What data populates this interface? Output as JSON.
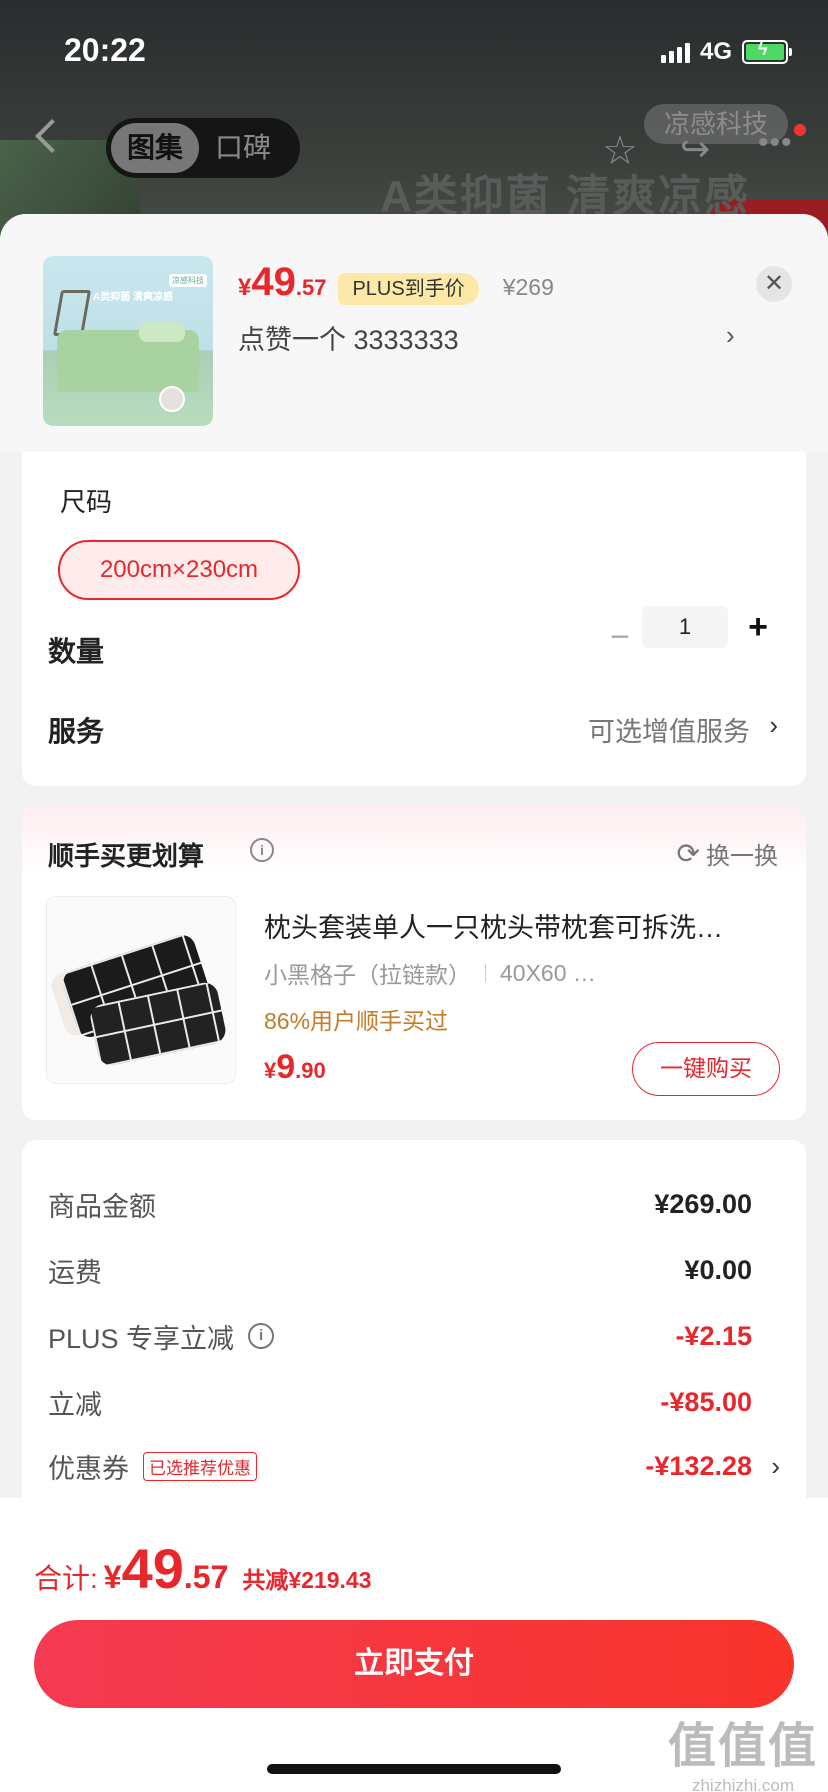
{
  "status_bar": {
    "time": "20:22",
    "network": "4G"
  },
  "background_page": {
    "tabs": [
      "图集",
      "口碑"
    ],
    "brand": "凉感科技",
    "slogan": "A类抑菌 清爽凉感"
  },
  "product": {
    "thumb_text": "A类抑菌 清爽凉感",
    "thumb_tag": "凉感科技",
    "price_symbol": "¥",
    "price_int": "49",
    "price_dec": ".57",
    "plus_badge": "PLUS到手价",
    "original_price": "¥269",
    "spec_text": "点赞一个  3333333"
  },
  "options": {
    "size_label": "尺码",
    "size_selected": "200cm×230cm",
    "qty_label": "数量",
    "qty_value": "1",
    "service_label": "服务",
    "service_value": "可选增值服务"
  },
  "addon": {
    "title": "顺手买更划算",
    "swap_label": "换一换",
    "name": "枕头套装单人一只枕头带枕套可拆洗…",
    "spec_a": "小黑格子（拉链款）",
    "spec_b": "40X60 …",
    "rate": "86%用户顺手买过",
    "price_symbol": "¥",
    "price_int": "9",
    "price_dec": ".90",
    "buy_label": "一键购买"
  },
  "summary": {
    "rows": [
      {
        "label": "商品金额",
        "value": "¥269.00"
      },
      {
        "label": "运费",
        "value": "¥0.00"
      },
      {
        "label": "PLUS 专享立减",
        "value": "-¥2.15"
      },
      {
        "label": "立减",
        "value": "-¥85.00"
      },
      {
        "label": "优惠券",
        "value": "-¥132.28",
        "tag": "已选推荐优惠"
      }
    ]
  },
  "footer": {
    "total_label": "合计:",
    "total_symbol": "¥",
    "total_int": "49",
    "total_dec": ".57",
    "total_off": "共减¥219.43",
    "pay_label": "立即支付"
  },
  "watermark": {
    "big": "值值值",
    "small": "zhizhizhi.com"
  },
  "colors": {
    "accent": "#e8272d",
    "plus_badge_bg": "#fde9a7",
    "coupon_rate": "#c47b2a"
  }
}
